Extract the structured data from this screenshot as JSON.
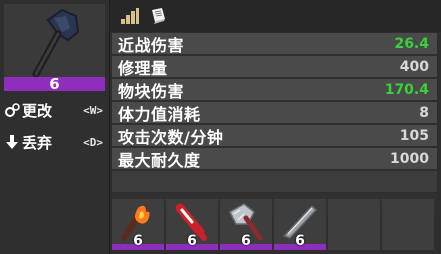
{
  "item": {
    "icon": "stone-axe-icon",
    "quality": "6",
    "quality_color": "#8f2dbd"
  },
  "actions": [
    {
      "label": "更改",
      "key": "<W>",
      "icon": "gear-icon"
    },
    {
      "label": "丢弃",
      "key": "<D>",
      "icon": "arrow-down-icon"
    }
  ],
  "tabs": [
    {
      "icon": "stats-bars-icon"
    },
    {
      "icon": "book-icon"
    }
  ],
  "stats": [
    {
      "name": "近战伤害",
      "value": "26.4",
      "highlight": true
    },
    {
      "name": "修理量",
      "value": "400",
      "highlight": false
    },
    {
      "name": "物块伤害",
      "value": "170.4",
      "highlight": true
    },
    {
      "name": "体力值消耗",
      "value": "8",
      "highlight": false
    },
    {
      "name": "攻击次数/分钟",
      "value": "105",
      "highlight": false
    },
    {
      "name": "最大耐久度",
      "value": "1000",
      "highlight": false
    }
  ],
  "mod_slots": [
    {
      "icon": "burning-shaft-mod-icon",
      "quality": "6"
    },
    {
      "icon": "red-grip-mod-icon",
      "quality": "6"
    },
    {
      "icon": "spiked-axe-mod-icon",
      "quality": "6"
    },
    {
      "icon": "blade-mod-icon",
      "quality": "6"
    },
    {
      "icon": "empty-slot",
      "quality": ""
    },
    {
      "icon": "empty-slot",
      "quality": ""
    }
  ],
  "colors": {
    "accent": "#8f2dbd",
    "green_value": "#37d23a",
    "row_bg": "#4a4a4a"
  }
}
